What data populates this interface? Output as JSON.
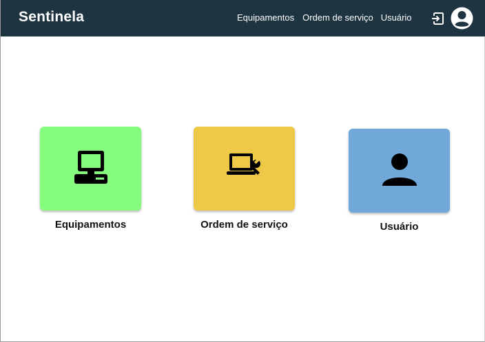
{
  "app": {
    "brand": "Sentinela"
  },
  "nav": {
    "links": [
      "Equipamentos",
      "Ordem de serviço",
      "Usuário"
    ],
    "logout_icon": "logout-icon",
    "account_icon": "account-circle-icon"
  },
  "cards": [
    {
      "label": "Equipamentos",
      "color": "#86fc7e",
      "icon": "desktop-computer-icon"
    },
    {
      "label": "Ordem de serviço",
      "color": "#eec847",
      "icon": "computer-repair-icon"
    },
    {
      "label": "Usuário",
      "color": "#6fa8d9",
      "icon": "person-icon"
    }
  ]
}
